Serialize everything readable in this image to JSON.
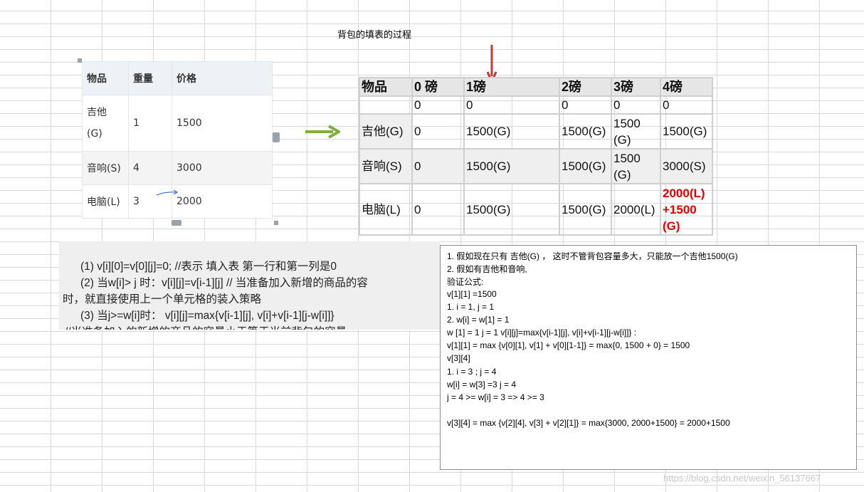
{
  "title": "背包的填表的过程",
  "items_table": {
    "headers": [
      "物品",
      "重量",
      "价格"
    ],
    "rows": [
      {
        "name": "吉他(G)",
        "weight": "1",
        "price": "1500"
      },
      {
        "name": "音响(S)",
        "weight": "4",
        "price": "3000"
      },
      {
        "name": "电脑(L)",
        "weight": "3",
        "price": "2000"
      }
    ]
  },
  "knapsack_table": {
    "headers": [
      "物品",
      "0 磅",
      "1磅",
      "2磅",
      "3磅",
      "4磅"
    ],
    "rows": [
      {
        "label": "",
        "cells": [
          "0",
          "0",
          "0",
          "0",
          "0"
        ]
      },
      {
        "label": "吉他(G)",
        "cells": [
          "0",
          "1500(G)",
          "1500(G)",
          "1500(G)",
          "1500(G)"
        ]
      },
      {
        "label": "音响(S)",
        "cells": [
          "0",
          "1500(G)",
          "1500(G)",
          "1500(G)",
          "3000(S)"
        ]
      },
      {
        "label": "电脑(L)",
        "cells": [
          "0",
          "1500(G)",
          "1500(G)",
          "2000(L)",
          "2000(L)+1500(G)"
        ]
      }
    ],
    "highlight_color": "#e00000"
  },
  "formula": {
    "line1": "(1)  v[i][0]=v[0][j]=0; //表示 填入表 第一行和第一列是0",
    "line2": "(2) 当w[i]> j 时：v[i][j]=v[i-1][j]  // 当准备加入新增的商品的容",
    "line3": "时，就直接使用上一个单元格的装入策略",
    "line4": "(3) 当j>=w[i]时：  v[i][j]=max{v[i-1][j], v[i]+v[i-1][j-w[i]]}",
    "line5": "//当准备加入的新增的商品的容量小于等于当前背包的容量"
  },
  "notes": [
    "1. 假如现在只有 吉他(G) ， 这时不管背包容量多大，只能放一个吉他1500(G)",
    "2. 假如有吉他和音响,",
    "验证公式:",
    "v[1][1] =1500",
    "1. i = 1, j = 1",
    "2. w[i] = w[1] = 1",
    "w [1] = 1  j = 1   v[i][j]=max{v[i-1][j], v[i]+v[i-1][j-w[i]]} :",
    "v[1][1] = max {v[0][1], v[1] + v[0][1-1]} = max{0, 1500 + 0} = 1500",
    "v[3][4]",
    "1. i = 3 ;  j = 4",
    "w[i] = w[3] =3 j = 4",
    "j = 4 >= w[i] = 3 => 4 >= 3",
    " v[3][4] = max {v[2][4], v[3] + v[2][1]} = max{3000, 2000+1500}  = 2000+1500"
  ],
  "watermark": "https://blog.csdn.net/weixin_56137667"
}
